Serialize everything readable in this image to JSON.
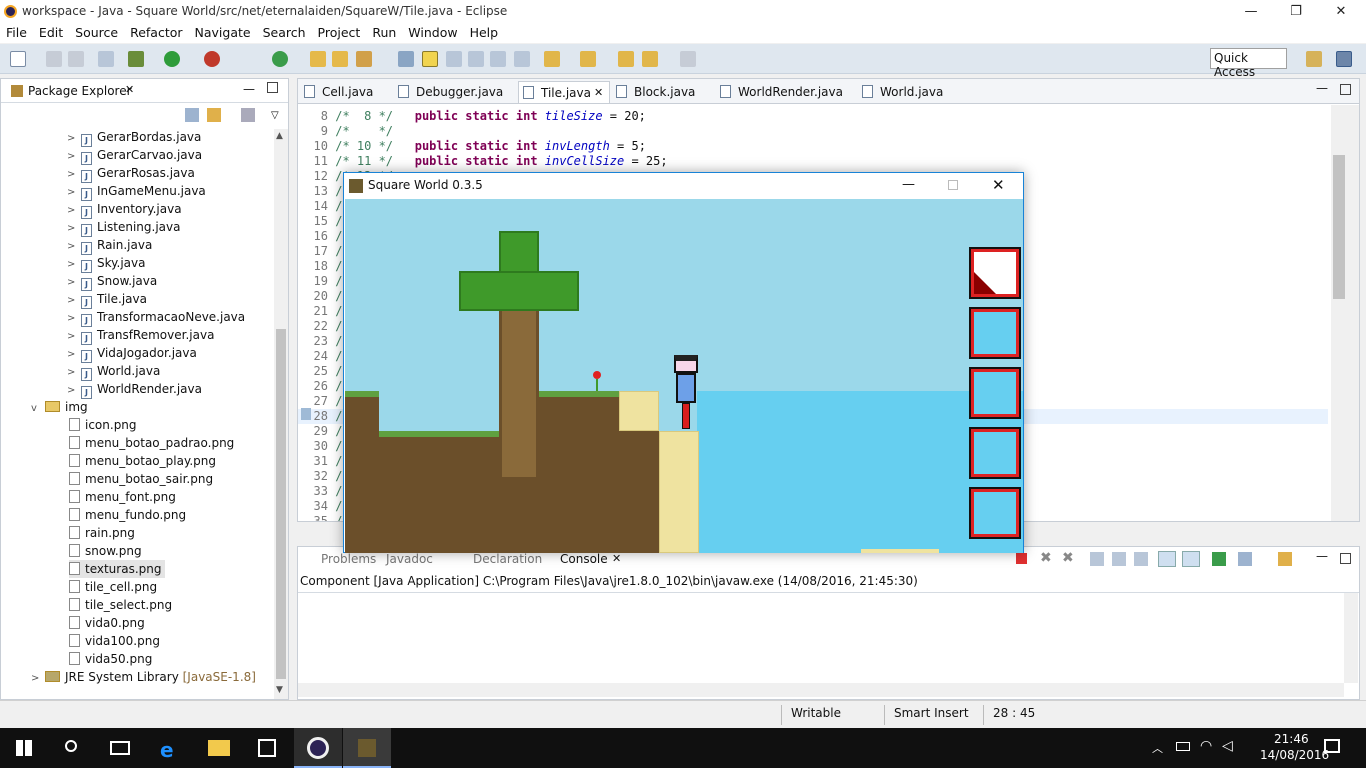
{
  "window": {
    "title": "workspace - Java - Square World/src/net/eternalaiden/SquareW/Tile.java - Eclipse",
    "minimize": "—",
    "restore": "❐",
    "close": "✕"
  },
  "menu": [
    "File",
    "Edit",
    "Source",
    "Refactor",
    "Navigate",
    "Search",
    "Project",
    "Run",
    "Window",
    "Help"
  ],
  "toolbar": {
    "quick_access": "Quick Access"
  },
  "package_explorer": {
    "title": "Package Explorer",
    "java_files": [
      "GerarBordas.java",
      "GerarCarvao.java",
      "GerarRosas.java",
      "InGameMenu.java",
      "Inventory.java",
      "Listening.java",
      "Rain.java",
      "Sky.java",
      "Snow.java",
      "Tile.java",
      "TransformacaoNeve.java",
      "TransfRemover.java",
      "VidaJogador.java",
      "World.java",
      "WorldRender.java"
    ],
    "img_folder": "img",
    "img_files": [
      "icon.png",
      "menu_botao_padrao.png",
      "menu_botao_play.png",
      "menu_botao_sair.png",
      "menu_font.png",
      "menu_fundo.png",
      "rain.png",
      "snow.png",
      "texturas.png",
      "tile_cell.png",
      "tile_select.png",
      "vida0.png",
      "vida100.png",
      "vida50.png"
    ],
    "jre": "JRE System Library",
    "jre_suffix": "[JavaSE-1.8]"
  },
  "editor": {
    "tabs": [
      "Cell.java",
      "Debugger.java",
      "Tile.java",
      "Block.java",
      "WorldRender.java",
      "World.java"
    ],
    "active_tab": "Tile.java",
    "lines": [
      {
        "n": "8",
        "c": "/*  8 */",
        "code": "public static int ",
        "f": "tileSize",
        "rest": " = 20;"
      },
      {
        "n": "9",
        "c": "/*    */",
        "code": "",
        "f": "",
        "rest": ""
      },
      {
        "n": "10",
        "c": "/* 10 */",
        "code": "public static int ",
        "f": "invLength",
        "rest": " = 5;"
      },
      {
        "n": "11",
        "c": "/* 11 */",
        "code": "public static int ",
        "f": "invCellSize",
        "rest": " = 25;"
      },
      {
        "n": "12",
        "c": "/* 12 */",
        "code": "",
        "f": "",
        "rest": ""
      },
      {
        "n": "13",
        "c": "/",
        "code": "",
        "f": "",
        "rest": ""
      },
      {
        "n": "14",
        "c": "/",
        "code": "",
        "f": "",
        "rest": ""
      },
      {
        "n": "15",
        "c": "/",
        "code": "",
        "f": "",
        "rest": ""
      },
      {
        "n": "16",
        "c": "/",
        "code": "",
        "f": "",
        "rest": ""
      },
      {
        "n": "17",
        "c": "/",
        "code": "",
        "f": "",
        "rest": ""
      },
      {
        "n": "18",
        "c": "/",
        "code": "",
        "f": "",
        "rest": ""
      },
      {
        "n": "19",
        "c": "/",
        "code": "",
        "f": "",
        "rest": ""
      },
      {
        "n": "20",
        "c": "/",
        "code": "",
        "f": "",
        "rest": ""
      },
      {
        "n": "21",
        "c": "/",
        "code": "",
        "f": "",
        "rest": ""
      },
      {
        "n": "22",
        "c": "/",
        "code": "",
        "f": "",
        "rest": ""
      },
      {
        "n": "23",
        "c": "/",
        "code": "",
        "f": "",
        "rest": ""
      },
      {
        "n": "24",
        "c": "/",
        "code": "",
        "f": "",
        "rest": ""
      },
      {
        "n": "25",
        "c": "/",
        "code": "",
        "f": "",
        "rest": ""
      },
      {
        "n": "26",
        "c": "/",
        "code": "",
        "f": "",
        "rest": ""
      },
      {
        "n": "27",
        "c": "/",
        "code": "",
        "f": "",
        "rest": ""
      },
      {
        "n": "28",
        "c": "/",
        "code": "",
        "f": "",
        "rest": ""
      },
      {
        "n": "29",
        "c": "/",
        "code": "",
        "f": "",
        "rest": ""
      },
      {
        "n": "30",
        "c": "/",
        "code": "",
        "f": "",
        "rest": ""
      },
      {
        "n": "31",
        "c": "/",
        "code": "",
        "f": "",
        "rest": ""
      },
      {
        "n": "32",
        "c": "/",
        "code": "",
        "f": "",
        "rest": ""
      },
      {
        "n": "33",
        "c": "/",
        "code": "",
        "f": "",
        "rest": ""
      },
      {
        "n": "34",
        "c": "/",
        "code": "",
        "f": "",
        "rest": ""
      },
      {
        "n": "35",
        "c": "/",
        "code": "",
        "f": "",
        "rest": ""
      }
    ]
  },
  "console": {
    "tabs": [
      "Problems",
      "Javadoc",
      "Declaration",
      "Console"
    ],
    "active_tab": "Console",
    "text": "Component [Java Application] C:\\Program Files\\Java\\jre1.8.0_102\\bin\\javaw.exe (14/08/2016, 21:45:30)"
  },
  "game": {
    "title": "Square World 0.3.5",
    "inventory_slots": 5
  },
  "status": {
    "writable": "Writable",
    "insert": "Smart Insert",
    "position": "28 : 45"
  },
  "taskbar": {
    "time": "21:46",
    "date": "14/08/2016"
  },
  "colors": {
    "accent": "#1883d7",
    "sky": "#9bd8ea",
    "water": "#66cff0"
  }
}
